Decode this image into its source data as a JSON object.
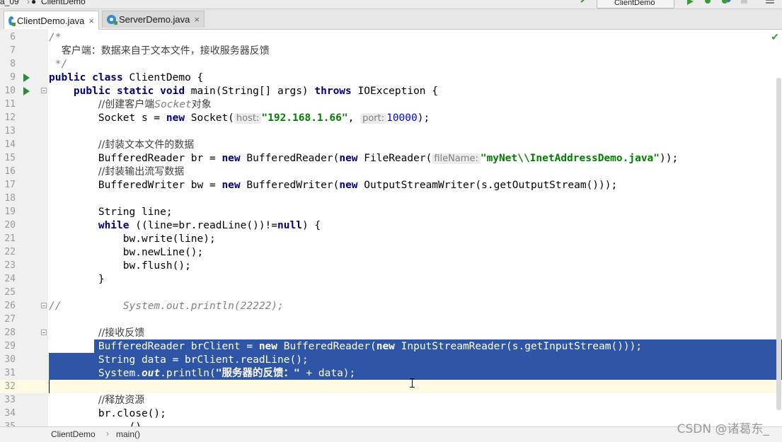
{
  "top_strip": {
    "crumbs": [
      "a_09",
      "ClientDemo"
    ],
    "run_config": "ClientDemo"
  },
  "tabs": [
    {
      "label": "ClientDemo.java",
      "active": true
    },
    {
      "label": "ServerDemo.java",
      "active": false
    }
  ],
  "editor": {
    "lines": [
      {
        "n": "6"
      },
      {
        "n": "7"
      },
      {
        "n": "8"
      },
      {
        "n": "9"
      },
      {
        "n": "10"
      },
      {
        "n": "11"
      },
      {
        "n": "12"
      },
      {
        "n": "13"
      },
      {
        "n": "14"
      },
      {
        "n": "15"
      },
      {
        "n": "16"
      },
      {
        "n": "17"
      },
      {
        "n": "18"
      },
      {
        "n": "19"
      },
      {
        "n": "20"
      },
      {
        "n": "21"
      },
      {
        "n": "22"
      },
      {
        "n": "23"
      },
      {
        "n": "24"
      },
      {
        "n": "25"
      },
      {
        "n": "26"
      },
      {
        "n": "27"
      },
      {
        "n": "28"
      },
      {
        "n": "29"
      },
      {
        "n": "30"
      },
      {
        "n": "31"
      },
      {
        "n": "32"
      },
      {
        "n": "33"
      },
      {
        "n": "34"
      },
      {
        "n": "35"
      }
    ],
    "code": {
      "l6": "/*",
      "l7": "    客户端：数据来自于文本文件，接收服务器反馈",
      "l8": " */",
      "l9_kw": "public class",
      "l9_rest": " ClientDemo {",
      "l10_kw": "public static void",
      "l10_mid": " main(String[] args) ",
      "l10_kw2": "throws",
      "l10_rest": " IOException {",
      "l11_pre": "//创建客户端",
      "l11_it": "Socket",
      "l11_post": "对象",
      "l12_a": "Socket s = ",
      "l12_new": "new",
      "l12_b": " Socket(",
      "l12_hint1": "host:",
      "l12_str": "\"192.168.1.66\"",
      "l12_c": ", ",
      "l12_hint2": "port:",
      "l12_num": "10000",
      "l12_d": ");",
      "l14": "//封装文本文件的数据",
      "l15_a": "BufferedReader br = ",
      "l15_new": "new",
      "l15_b": " BufferedReader(",
      "l15_new2": "new",
      "l15_c": " FileReader(",
      "l15_hint": "fileName:",
      "l15_str": "\"myNet\\\\InetAddressDemo.java\"",
      "l15_d": "));",
      "l16": "//封装输出流写数据",
      "l17_a": "BufferedWriter bw = ",
      "l17_new": "new",
      "l17_b": " BufferedWriter(",
      "l17_new2": "new",
      "l17_c": " OutputStreamWriter(s.getOutputStream()));",
      "l19": "String line;",
      "l20_kw": "while",
      "l20_a": " ((line=br.readLine())!=",
      "l20_null": "null",
      "l20_b": ") {",
      "l21": "bw.write(line);",
      "l22": "bw.newLine();",
      "l23": "bw.flush();",
      "l24": "}",
      "l26_a": "//",
      "l26_b": "System.out.println(22222);",
      "l28": "//接收反馈",
      "l29_a": "BufferedReader brClient = ",
      "l29_new": "new",
      "l29_b": " BufferedReader(",
      "l29_new2": "new",
      "l29_c": " InputStreamReader(s.getInputStream()));",
      "l30": "String data = brClient.readLine();",
      "l31_a": "System.",
      "l31_out": "out",
      "l31_b": ".println(",
      "l31_str": "\"服务器的反馈：\"",
      "l31_c": " + data);",
      "l33": "//释放资源",
      "l34": "br.close();",
      "l35": "     ()"
    }
  },
  "breadcrumb": {
    "items": [
      "ClientDemo",
      "main()"
    ],
    "separator": "›"
  },
  "watermark": "CSDN @诸葛东_",
  "colors": {
    "keyword": "#000080",
    "string": "#008000",
    "number": "#0000ff",
    "comment": "#808080",
    "selection": "#2f56a6",
    "current_line": "#fffae3"
  }
}
